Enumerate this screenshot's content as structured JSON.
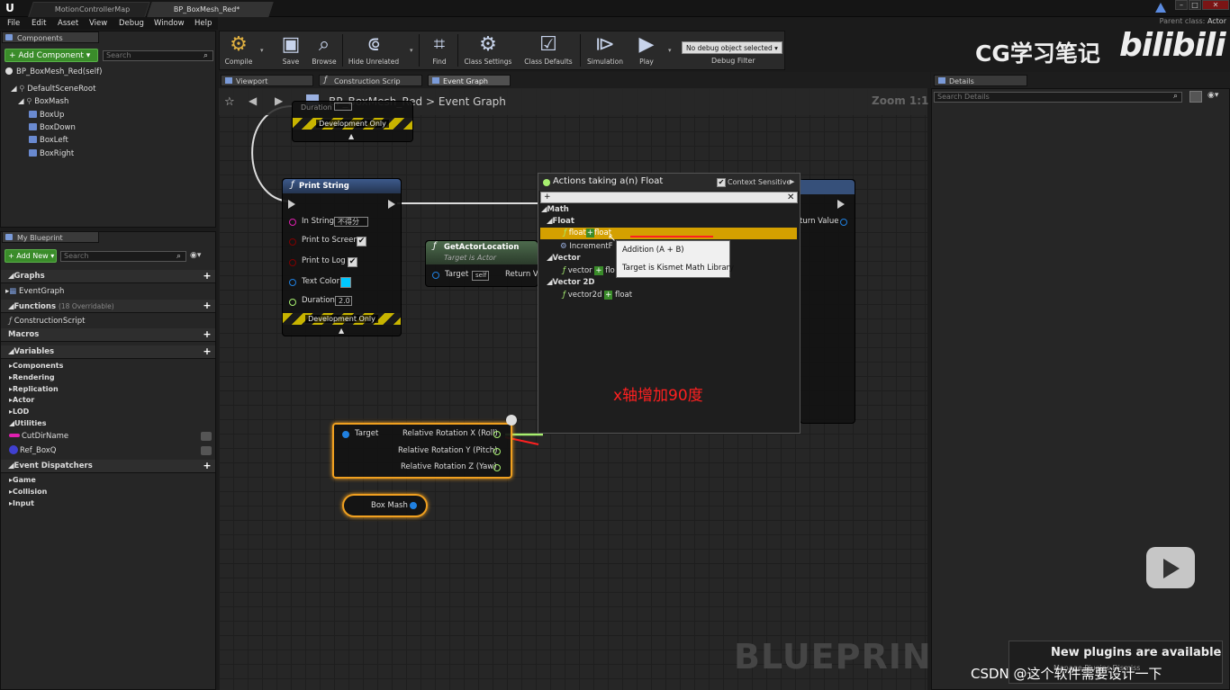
{
  "titlebar": {
    "tabs": [
      "MotionControllerMap",
      "BP_BoxMesh_Red*"
    ],
    "parent_class_label": "Parent class:",
    "parent_class_value": "Actor"
  },
  "menu": [
    "File",
    "Edit",
    "Asset",
    "View",
    "Debug",
    "Window",
    "Help"
  ],
  "components": {
    "tab": "Components",
    "add_button": "+ Add Component ▾",
    "search_placeholder": "Search",
    "self_item": "BP_BoxMesh_Red(self)",
    "tree": [
      "DefaultSceneRoot",
      "BoxMash",
      "BoxUp",
      "BoxDown",
      "BoxLeft",
      "BoxRight"
    ]
  },
  "my_blueprint": {
    "tab": "My Blueprint",
    "add_new": "+ Add New ▾",
    "search_placeholder": "Search",
    "graphs": "Graphs",
    "event_graph": "EventGraph",
    "functions": "Functions",
    "functions_count": "(18 Overridable)",
    "construction_script": "ConstructionScript",
    "macros": "Macros",
    "variables": "Variables",
    "categories": [
      "Components",
      "Rendering",
      "Replication",
      "Actor",
      "LOD",
      "Utilities"
    ],
    "vars": [
      {
        "name": "CutDirName",
        "color": "#e020b0"
      },
      {
        "name": "Ref_BoxQ",
        "color": "#4040d0"
      }
    ],
    "event_dispatchers": "Event Dispatchers",
    "dispatcher_cats": [
      "Game",
      "Collision",
      "Input"
    ]
  },
  "toolbar": {
    "buttons": [
      "Compile",
      "Save",
      "Browse",
      "Hide Unrelated",
      "Find",
      "Class Settings",
      "Class Defaults",
      "Simulation",
      "Play"
    ],
    "debug_select": "No debug object selected ▾",
    "debug_filter": "Debug Filter"
  },
  "editor_tabs": [
    "Viewport",
    "Construction Scrip",
    "Event Graph"
  ],
  "breadcrumb": {
    "blueprint": "BP_BoxMesh_Red",
    "separator": ">",
    "graph": "Event Graph"
  },
  "zoom": "Zoom 1:1",
  "watermark_blueprint": "BLUEPRINT",
  "nodes": {
    "top_dev_only": "Development Only",
    "top_duration_label": "Duration",
    "print_string": {
      "title": "Print String",
      "in_string": "In String",
      "in_string_value": "不得分",
      "print_to_screen": "Print to Screen",
      "print_to_log": "Print to Log",
      "text_color": "Text Color",
      "duration": "Duration",
      "duration_value": "2.0",
      "dev_only": "Development Only"
    },
    "get_actor_location": {
      "title": "GetActorLocation",
      "subtitle": "Target is Actor",
      "target": "Target",
      "target_value": "self",
      "return": "Return Va"
    },
    "hidden_return_value": "turn Value",
    "break_rotator": {
      "target": "Target",
      "roll": "Relative Rotation X (Roll)",
      "pitch": "Relative Rotation Y (Pitch)",
      "yaw": "Relative Rotation Z (Yaw)"
    },
    "box_mash": "Box Mash"
  },
  "popup": {
    "title": "Actions taking a(n) Float",
    "context_sensitive": "Context Sensitive",
    "search_value": "+",
    "math": "Math",
    "float_cat": "Float",
    "item_float_plus": [
      "float",
      "+",
      "float"
    ],
    "increment": "IncrementF",
    "vector_cat": "Vector",
    "vector_item": [
      "vector",
      "+",
      "flo"
    ],
    "vector2d_cat": "Vector 2D",
    "vector2d_item": [
      "vector2d",
      "+",
      "float"
    ],
    "tooltip_line1": "Addition (A + B)",
    "tooltip_line2": "Target is Kismet Math Library",
    "annotation": "x轴增加90度"
  },
  "details": {
    "tab": "Details",
    "search_placeholder": "Search Details"
  },
  "overlays": {
    "cg_watermark": "CG学习笔记",
    "bilibili": "bilibili",
    "notification": "New plugins are available",
    "notification_sub": "Manage Plugins   Dismiss",
    "csdn": "CSDN @这个软件需要设计一下"
  },
  "colors": {
    "accent_green": "#3a8c2a",
    "selected_row": "#d4a000",
    "annotation_red": "#ff2020",
    "function_header": "#36507a",
    "pure_header": "#4d6b4d",
    "node_select_orange": "#f0a020"
  }
}
